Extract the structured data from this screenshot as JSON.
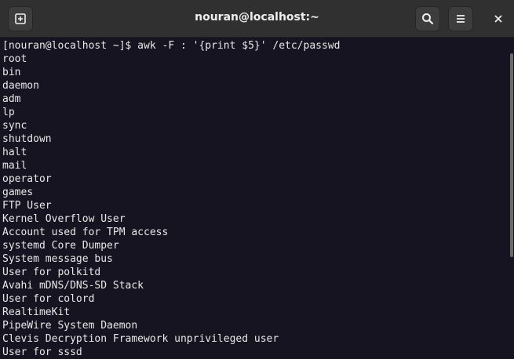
{
  "window": {
    "title": "nouran@localhost:~"
  },
  "titlebar": {
    "new_tab_icon": "new-tab-icon",
    "search_icon": "search-icon",
    "menu_icon": "hamburger-menu-icon",
    "close_icon": "close-icon"
  },
  "colors": {
    "titlebar_bg": "#303030",
    "terminal_bg": "#171421",
    "terminal_fg": "#e8e8e8"
  },
  "terminal": {
    "lines": [
      "[nouran@localhost ~]$ awk -F : '{print $5}' /etc/passwd",
      "root",
      "bin",
      "daemon",
      "adm",
      "lp",
      "sync",
      "shutdown",
      "halt",
      "mail",
      "operator",
      "games",
      "FTP User",
      "Kernel Overflow User",
      "Account used for TPM access",
      "systemd Core Dumper",
      "System message bus",
      "User for polkitd",
      "Avahi mDNS/DNS-SD Stack",
      "User for colord",
      "RealtimeKit",
      "PipeWire System Daemon",
      "Clevis Decryption Framework unprivileged user",
      "User for sssd"
    ]
  }
}
